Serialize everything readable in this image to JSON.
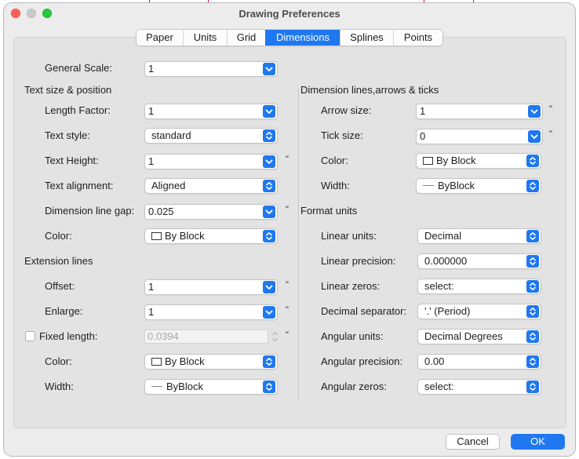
{
  "window": {
    "title": "Drawing Preferences"
  },
  "tabs": [
    "Paper",
    "Units",
    "Grid",
    "Dimensions",
    "Splines",
    "Points"
  ],
  "active_tab": "Dimensions",
  "general": {
    "scale_label": "General Scale:",
    "scale_value": "1"
  },
  "text": {
    "section": "Text size & position",
    "length_factor_label": "Length Factor:",
    "length_factor_value": "1",
    "style_label": "Text style:",
    "style_value": "standard",
    "height_label": "Text Height:",
    "height_value": "1",
    "height_unit": "\"",
    "alignment_label": "Text alignment:",
    "alignment_value": "Aligned",
    "gap_label": "Dimension line gap:",
    "gap_value": "0.025",
    "gap_unit": "\"",
    "color_label": "Color:",
    "color_value": "By Block"
  },
  "extension": {
    "section": "Extension lines",
    "offset_label": "Offset:",
    "offset_value": "1",
    "offset_unit": "\"",
    "enlarge_label": "Enlarge:",
    "enlarge_value": "1",
    "enlarge_unit": "\"",
    "fixed_label": "Fixed length:",
    "fixed_value": "0.0394",
    "fixed_unit": "\"",
    "fixed_checked": false,
    "color_label": "Color:",
    "color_value": "By Block",
    "width_label": "Width:",
    "width_value": "ByBlock"
  },
  "dimlines": {
    "section": "Dimension lines,arrows & ticks",
    "arrow_label": "Arrow size:",
    "arrow_value": "1",
    "arrow_unit": "\"",
    "tick_label": "Tick size:",
    "tick_value": "0",
    "tick_unit": "\"",
    "color_label": "Color:",
    "color_value": "By Block",
    "width_label": "Width:",
    "width_value": "ByBlock"
  },
  "format": {
    "section": "Format units",
    "linear_units_label": "Linear units:",
    "linear_units_value": "Decimal",
    "linear_precision_label": "Linear precision:",
    "linear_precision_value": "0.000000",
    "linear_zeros_label": "Linear zeros:",
    "linear_zeros_value": "select:",
    "decimal_sep_label": "Decimal separator:",
    "decimal_sep_value": "'.' (Period)",
    "angular_units_label": "Angular units:",
    "angular_units_value": "Decimal Degrees",
    "angular_precision_label": "Angular precision:",
    "angular_precision_value": "0.00",
    "angular_zeros_label": "Angular zeros:",
    "angular_zeros_value": "select:"
  },
  "buttons": {
    "cancel": "Cancel",
    "ok": "OK"
  },
  "colors": {
    "accent": "#1f78f0",
    "close": "#ff5f57",
    "zoom": "#28c840",
    "background_lines": "#d6006e"
  }
}
